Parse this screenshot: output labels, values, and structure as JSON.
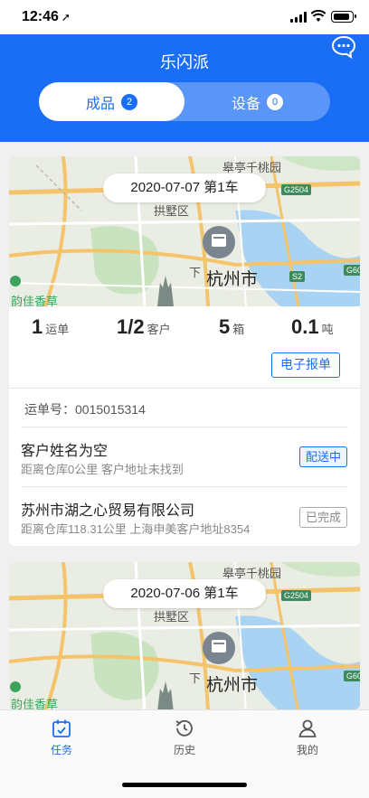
{
  "status_bar": {
    "time": "12:46",
    "location_arrow": "➚"
  },
  "header": {
    "title": "乐闪派",
    "chat_icon": "chat-bubble-icon"
  },
  "segments": [
    {
      "label": "成品",
      "count": "2",
      "active": true
    },
    {
      "label": "设备",
      "count": "0",
      "active": false
    }
  ],
  "map_labels": {
    "area1": "皋亭千桃园",
    "area2": "拱墅区",
    "area3": "下",
    "city": "杭州市",
    "poi": "韵佳香草",
    "hw1": "G2504",
    "hw2": "S2",
    "hw3": "G60"
  },
  "cards": [
    {
      "date_title": "2020-07-07  第1车",
      "stats": [
        {
          "num": "1",
          "unit": "运单"
        },
        {
          "num": "1/2",
          "unit": "客户"
        },
        {
          "num": "5",
          "unit": "箱"
        },
        {
          "num": "0.1",
          "unit": "吨"
        }
      ],
      "eform_label": "电子报单",
      "waybill": "运单号：0015015314",
      "customers": [
        {
          "name": "客户姓名为空",
          "sub": "距离仓库0公里  客户地址未找到",
          "status": "配送中"
        },
        {
          "name": "苏州市湖之心贸易有限公司",
          "sub": "距离仓库118.31公里  上海申美客户地址8354",
          "status": "已完成"
        }
      ]
    },
    {
      "date_title": "2020-07-06  第1车"
    }
  ],
  "tabbar": [
    {
      "label": "任务",
      "icon": "calendar-check-icon",
      "active": true
    },
    {
      "label": "历史",
      "icon": "history-clock-icon",
      "active": false
    },
    {
      "label": "我的",
      "icon": "user-icon",
      "active": false
    }
  ],
  "colors": {
    "primary": "#1a6ef5",
    "background": "#f0f0f0"
  }
}
